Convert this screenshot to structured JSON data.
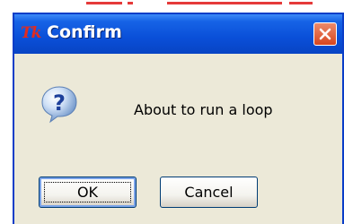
{
  "dialog": {
    "app_icon_text": "Tk",
    "title": "Confirm",
    "message": "About to run a loop",
    "icon": "question-icon",
    "buttons": {
      "ok_label": "OK",
      "cancel_label": "Cancel"
    },
    "colors": {
      "titlebar": "#0a4fd8",
      "window_body": "#ece9d8",
      "close_button": "#d8461f",
      "app_icon": "#e12b1f"
    }
  }
}
